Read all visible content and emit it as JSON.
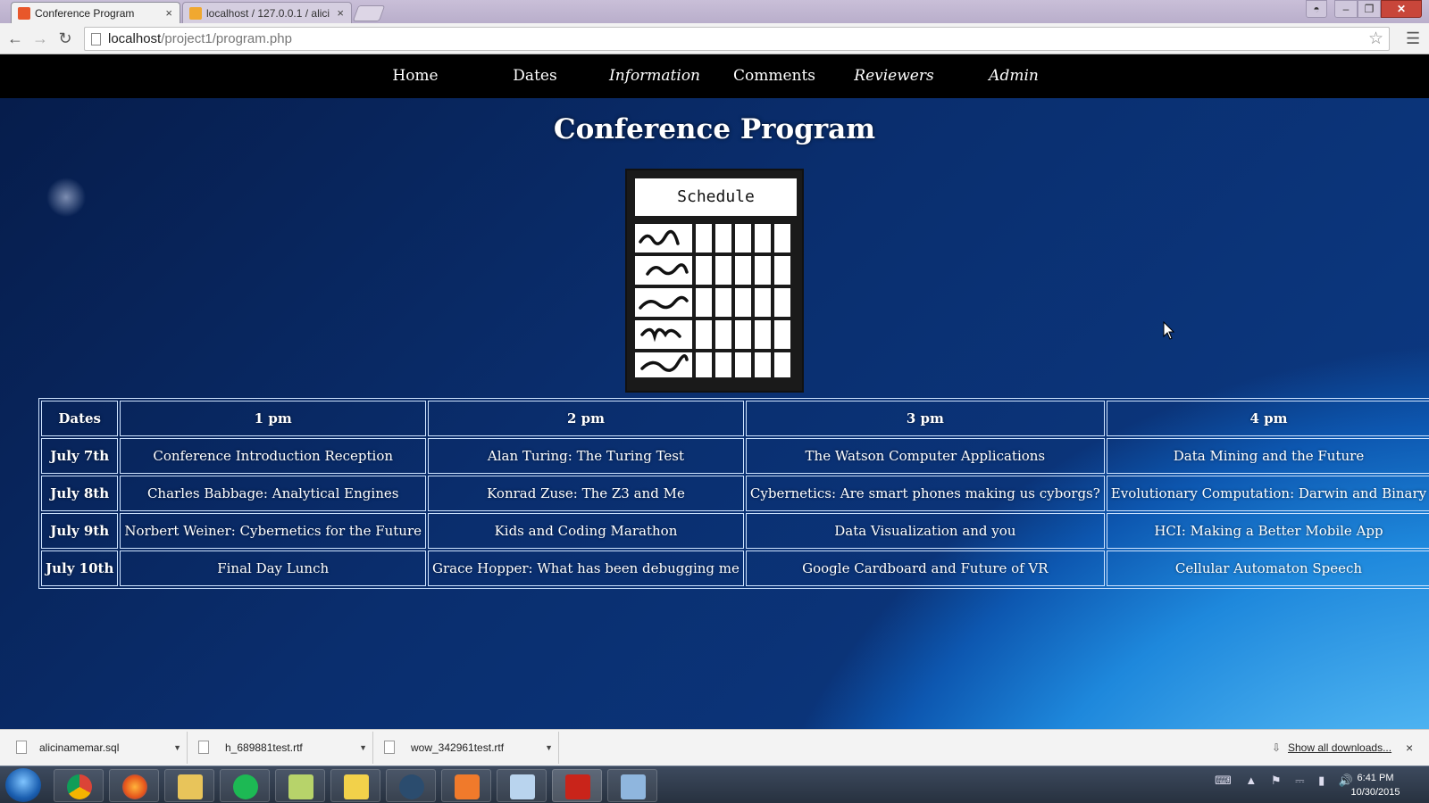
{
  "browser": {
    "tabs": [
      {
        "title": "Conference Program",
        "close": "×"
      },
      {
        "title": "localhost / 127.0.0.1 / alici",
        "close": "×"
      }
    ],
    "url_host": "localhost",
    "url_path": "/project1/program.php",
    "window_controls": {
      "minimize": "–",
      "maximize": "❐",
      "close": "✕",
      "user": "◓"
    }
  },
  "site_nav": [
    {
      "label": "Home",
      "italic": false
    },
    {
      "label": "Dates",
      "italic": false
    },
    {
      "label": "Information",
      "italic": true
    },
    {
      "label": "Comments",
      "italic": false
    },
    {
      "label": "Reviewers",
      "italic": true
    },
    {
      "label": "Admin",
      "italic": true
    }
  ],
  "page": {
    "title": "Conference Program",
    "schedule_image_label": "Schedule"
  },
  "program": {
    "headers": [
      "Dates",
      "1 pm",
      "2 pm",
      "3 pm",
      "4 pm"
    ],
    "rows": [
      {
        "date": "July 7th",
        "sessions": [
          "Conference Introduction Reception",
          "Alan Turing: The Turing Test",
          "The Watson Computer Applications",
          "Data Mining and the Future"
        ]
      },
      {
        "date": "July 8th",
        "sessions": [
          "Charles Babbage: Analytical Engines",
          "Konrad Zuse: The Z3 and Me",
          "Cybernetics: Are smart phones making us cyborgs?",
          "Evolutionary Computation: Darwin and Binary"
        ]
      },
      {
        "date": "July 9th",
        "sessions": [
          "Norbert Weiner: Cybernetics for the Future",
          "Kids and Coding Marathon",
          "Data Visualization and you",
          "HCI: Making a Better Mobile App"
        ]
      },
      {
        "date": "July 10th",
        "sessions": [
          "Final Day Lunch",
          "Grace Hopper: What has been debugging me",
          "Google Cardboard and Future of VR",
          "Cellular Automaton Speech"
        ]
      }
    ]
  },
  "downloads": {
    "items": [
      "alicinamemar.sql",
      "h_689881test.rtf",
      "wow_342961test.rtf"
    ],
    "show_all": "Show all downloads...",
    "close": "×"
  },
  "taskbar": {
    "icons": [
      "chrome-icon",
      "firefox-icon",
      "file-explorer-icon",
      "spotify-icon",
      "chart-app-icon",
      "live-icon",
      "steam-icon",
      "xampp-icon",
      "cube-app-icon",
      "acrobat-icon",
      "control-panel-icon"
    ],
    "time": "6:41 PM",
    "date": "10/30/2015"
  },
  "colors": {
    "nav_bg": "#000000",
    "table_border": "#cfe4ff",
    "close_red": "#c8463a"
  }
}
